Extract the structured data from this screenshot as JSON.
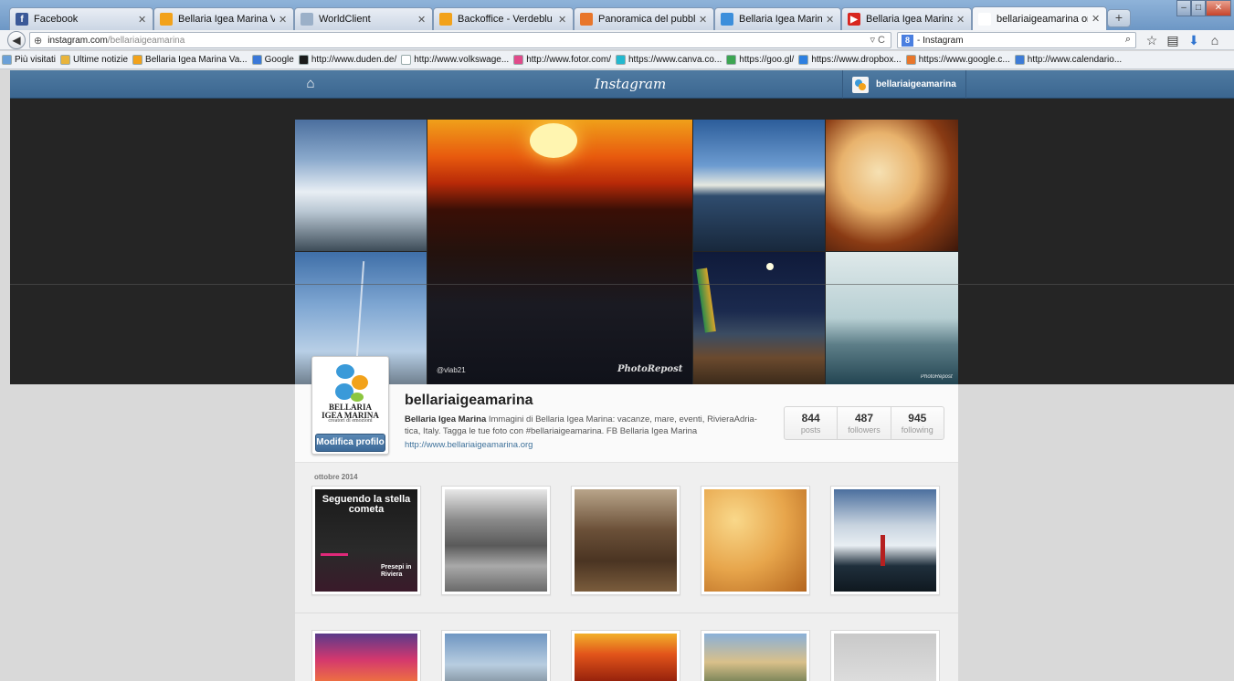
{
  "browser": {
    "tabs": [
      {
        "label": "Facebook",
        "icon": "facebook-icon",
        "color": "#3b5998",
        "glyph": "f"
      },
      {
        "label": "Bellaria Igea Marina Vacanz...",
        "icon": "bellaria-icon",
        "color": "#f2a21b",
        "glyph": ""
      },
      {
        "label": "WorldClient",
        "icon": "worldclient-icon",
        "color": "#9bb0c8",
        "glyph": ""
      },
      {
        "label": "Backoffice - Verdeblu",
        "icon": "bellaria-icon",
        "color": "#f2a21b",
        "glyph": ""
      },
      {
        "label": "Panoramica del pubblico - ...",
        "icon": "analytics-icon",
        "color": "#e8762b",
        "glyph": ""
      },
      {
        "label": "Bellaria Igea Marina - Goog...",
        "icon": "google-maps-icon",
        "color": "#3d8fdb",
        "glyph": ""
      },
      {
        "label": "Bellaria Igea Marina - YouT...",
        "icon": "youtube-icon",
        "color": "#d8261f",
        "glyph": "▶"
      },
      {
        "label": "bellariaigeamarina on Instagram",
        "icon": "instagram-icon",
        "color": "#ffffff",
        "glyph": ""
      }
    ],
    "new_tab": "+",
    "url_domain": "instagram.com",
    "url_path": "/bellariaigeamarina",
    "search_text": "- Instagram",
    "bookmarks": [
      {
        "label": "Più visitati",
        "icon": "most-visited-icon",
        "color": "#6aa0d8"
      },
      {
        "label": "Ultime notizie",
        "icon": "rss-folder-icon",
        "color": "#e9b43a"
      },
      {
        "label": "Bellaria Igea Marina Va...",
        "icon": "bellaria-icon",
        "color": "#f2a21b"
      },
      {
        "label": "Google",
        "icon": "google-icon",
        "color": "#3a78d8"
      },
      {
        "label": "http://www.duden.de/",
        "icon": "duden-icon",
        "color": "#1a1a1a"
      },
      {
        "label": "http://www.volkswage...",
        "icon": "page-icon",
        "color": "#ffffff"
      },
      {
        "label": "http://www.fotor.com/",
        "icon": "fotor-icon",
        "color": "#e04a8a"
      },
      {
        "label": "https://www.canva.co...",
        "icon": "canva-icon",
        "color": "#22b8cf"
      },
      {
        "label": "https://goo.gl/",
        "icon": "googl-icon",
        "color": "#3ca552"
      },
      {
        "label": "https://www.dropbox...",
        "icon": "dropbox-icon",
        "color": "#2d7fe0"
      },
      {
        "label": "https://www.google.c...",
        "icon": "analytics-icon",
        "color": "#e8762b"
      },
      {
        "label": "http://www.calendario...",
        "icon": "calendar-icon",
        "color": "#3e7bd6"
      }
    ]
  },
  "instagram": {
    "logo": "Instagram",
    "username": "bellariaigeamarina",
    "profile": {
      "name": "bellariaigeamarina",
      "bio_bold": "Bellaria Igea Marina",
      "bio": " Immagini di Bellaria Igea Marina: vacanze, mare, eventi, RivieraAdria-tica, Italy. Tagga le tue foto con #bellariaigeamarina. FB Bellaria Igea Marina",
      "website": "http://www.bellariaigeamarina.org",
      "edit_button": "Modifica profilo",
      "avatar_title_1": "BELLARIA",
      "avatar_title_2": "IGEA MARINA",
      "avatar_subtitle": "creatori di emozioni"
    },
    "stats": [
      {
        "value": "844",
        "label": "posts"
      },
      {
        "value": "487",
        "label": "followers"
      },
      {
        "value": "945",
        "label": "following"
      }
    ],
    "mosaic_captions": {
      "large_left": "@vlab21",
      "large_right": "PhotoRepost"
    },
    "feed": {
      "month": "ottobre 2014",
      "first_post_title": "Seguendo la stella cometa",
      "first_post_sub": "Presepi in Riviera"
    }
  }
}
